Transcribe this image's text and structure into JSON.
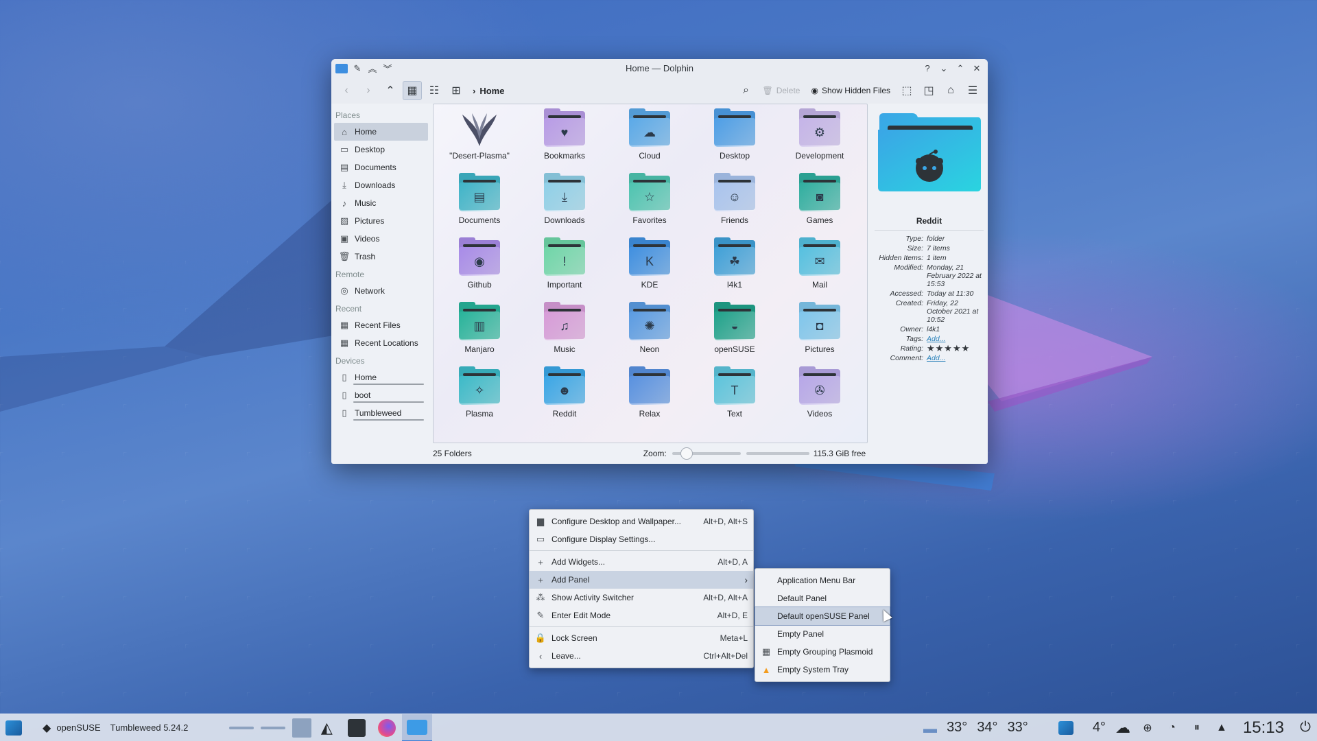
{
  "window": {
    "title": "Home — Dolphin",
    "toolbar": {
      "breadcrumb": "Home",
      "delete_label": "Delete",
      "hidden_files_label": "Show Hidden Files"
    },
    "sidebar": {
      "sections": [
        {
          "title": "Places",
          "items": [
            {
              "label": "Home",
              "icon": "home-icon",
              "selected": true
            },
            {
              "label": "Desktop",
              "icon": "desktop-icon"
            },
            {
              "label": "Documents",
              "icon": "document-icon"
            },
            {
              "label": "Downloads",
              "icon": "download-icon"
            },
            {
              "label": "Music",
              "icon": "music-icon"
            },
            {
              "label": "Pictures",
              "icon": "picture-icon"
            },
            {
              "label": "Videos",
              "icon": "video-icon"
            },
            {
              "label": "Trash",
              "icon": "trash-icon"
            }
          ]
        },
        {
          "title": "Remote",
          "items": [
            {
              "label": "Network",
              "icon": "network-icon"
            }
          ]
        },
        {
          "title": "Recent",
          "items": [
            {
              "label": "Recent Files",
              "icon": "recent-files-icon"
            },
            {
              "label": "Recent Locations",
              "icon": "recent-locations-icon"
            }
          ]
        },
        {
          "title": "Devices",
          "items": [
            {
              "label": "Home",
              "icon": "drive-icon"
            },
            {
              "label": "boot",
              "icon": "drive-icon"
            },
            {
              "label": "Tumbleweed",
              "icon": "drive-icon"
            }
          ]
        }
      ]
    },
    "files": [
      {
        "name": "\"Desert-Plasma\"",
        "kind": "image",
        "color": "#4b4f66"
      },
      {
        "name": "Bookmarks",
        "glyph": "♥",
        "color": "#b89be6"
      },
      {
        "name": "Cloud",
        "glyph": "☁",
        "color": "#5aa9e8"
      },
      {
        "name": "Desktop",
        "glyph": "",
        "color": "#4d9ee6"
      },
      {
        "name": "Development",
        "glyph": "⚙",
        "color": "#c5b4e8"
      },
      {
        "name": "Documents",
        "glyph": "▤",
        "color": "#3fb4c8"
      },
      {
        "name": "Downloads",
        "glyph": "⤓",
        "color": "#8fd0e8"
      },
      {
        "name": "Favorites",
        "glyph": "☆",
        "color": "#4dc4b0"
      },
      {
        "name": "Friends",
        "glyph": "☺",
        "color": "#a9c4ee"
      },
      {
        "name": "Games",
        "glyph": "◙",
        "color": "#2fae9f"
      },
      {
        "name": "Github",
        "glyph": "◉",
        "color": "#a88be8"
      },
      {
        "name": "Important",
        "glyph": "!",
        "color": "#6fd6a8"
      },
      {
        "name": "KDE",
        "glyph": "K",
        "color": "#3f8fe0"
      },
      {
        "name": "l4k1",
        "glyph": "☘",
        "color": "#3fa0d8"
      },
      {
        "name": "Mail",
        "glyph": "✉",
        "color": "#55c0e0"
      },
      {
        "name": "Manjaro",
        "glyph": "▥",
        "color": "#27b39a"
      },
      {
        "name": "Music",
        "glyph": "♫",
        "color": "#d79bd8"
      },
      {
        "name": "Neon",
        "glyph": "✺",
        "color": "#5a9be2"
      },
      {
        "name": "openSUSE",
        "glyph": "◒",
        "color": "#1fa28a"
      },
      {
        "name": "Pictures",
        "glyph": "◘",
        "color": "#7fc6ec"
      },
      {
        "name": "Plasma",
        "glyph": "✧",
        "color": "#3cbac8"
      },
      {
        "name": "Reddit",
        "glyph": "☻",
        "color": "#3aa6e6"
      },
      {
        "name": "Relax",
        "glyph": "",
        "color": "#5891e0"
      },
      {
        "name": "Text",
        "glyph": "T",
        "color": "#5cc4dc"
      },
      {
        "name": "Videos",
        "glyph": "✇",
        "color": "#b7a7e8"
      }
    ],
    "info": {
      "name": "Reddit",
      "rows": [
        {
          "k": "Type:",
          "v": "folder"
        },
        {
          "k": "Size:",
          "v": "7 items"
        },
        {
          "k": "Hidden Items:",
          "v": "1 item"
        },
        {
          "k": "Modified:",
          "v": "Monday, 21 February 2022 at 15:53"
        },
        {
          "k": "Accessed:",
          "v": "Today at 11:30"
        },
        {
          "k": "Created:",
          "v": "Friday, 22 October 2021 at 10:52"
        },
        {
          "k": "Owner:",
          "v": "l4k1"
        },
        {
          "k": "Tags:",
          "v": "Add...",
          "link": true
        },
        {
          "k": "Rating:",
          "v": "★★★★★",
          "stars": true
        },
        {
          "k": "Comment:",
          "v": "Add...",
          "link": true
        }
      ]
    },
    "status": {
      "folders": "25 Folders",
      "zoom_label": "Zoom:",
      "free": "115.3 GiB free"
    }
  },
  "context_menu": [
    {
      "label": "Configure Desktop and Wallpaper...",
      "shortcut": "Alt+D, Alt+S",
      "icon": "wallpaper-icon"
    },
    {
      "label": "Configure Display Settings...",
      "shortcut": "",
      "icon": "display-icon"
    },
    {
      "sep": true
    },
    {
      "label": "Add Widgets...",
      "shortcut": "Alt+D, A",
      "icon": "plus-icon"
    },
    {
      "label": "Add Panel",
      "shortcut": "",
      "icon": "plus-icon",
      "submenu": true,
      "highlight": true
    },
    {
      "label": "Show Activity Switcher",
      "shortcut": "Alt+D, Alt+A",
      "icon": "activities-icon"
    },
    {
      "label": "Enter Edit Mode",
      "shortcut": "Alt+D, E",
      "icon": "pencil-icon"
    },
    {
      "sep": true
    },
    {
      "label": "Lock Screen",
      "shortcut": "Meta+L",
      "icon": "lock-icon"
    },
    {
      "label": "Leave...",
      "shortcut": "Ctrl+Alt+Del",
      "icon": "leave-icon"
    }
  ],
  "submenu": [
    {
      "label": "Application Menu Bar",
      "icon": ""
    },
    {
      "label": "Default Panel",
      "icon": ""
    },
    {
      "label": "Default openSUSE Panel",
      "icon": "",
      "highlight": true
    },
    {
      "label": "Empty Panel",
      "icon": ""
    },
    {
      "label": "Empty Grouping Plasmoid",
      "icon": "grouping-icon"
    },
    {
      "label": "Empty System Tray",
      "icon": "warning-icon"
    }
  ],
  "taskbar": {
    "distro": "openSUSE",
    "version": "Tumbleweed 5.24.2",
    "temps": [
      "33°",
      "34°",
      "33°"
    ],
    "weather": "4°",
    "clock": "15:13"
  }
}
